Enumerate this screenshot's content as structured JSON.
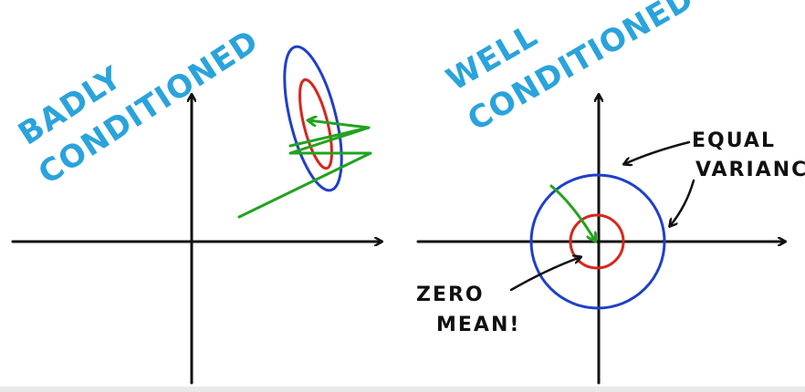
{
  "left_panel": {
    "title_line1": "BADLY",
    "title_line2": "CONDITIONED"
  },
  "right_panel": {
    "title_line1": "WELL",
    "title_line2": "CONDITIONED",
    "annotation_variance_line1": "EQUAL",
    "annotation_variance_line2": "VARIANCE!",
    "annotation_mean_line1": "ZERO",
    "annotation_mean_line2": "MEAN!"
  },
  "colors": {
    "title": "#2aa3dc",
    "axes": "#111111",
    "outer_contour": "#1f3fc9",
    "inner_contour": "#d8261c",
    "optimization_path": "#22a31f"
  }
}
